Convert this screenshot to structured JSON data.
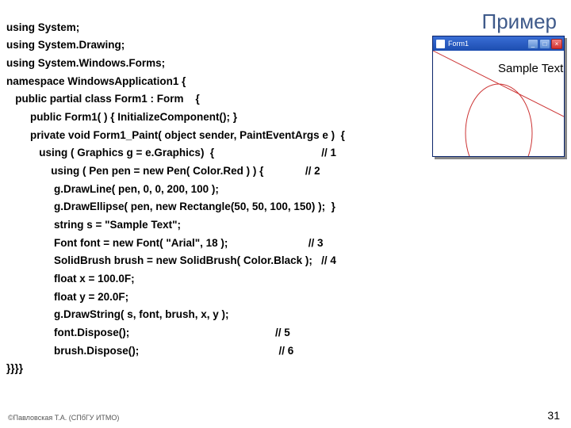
{
  "title": "Пример",
  "code_lines": [
    "using System;",
    "using System.Drawing;",
    "using System.Windows.Forms;",
    "namespace WindowsApplication1 {",
    "   public partial class Form1 : Form    {",
    "        public Form1( ) { InitializeComponent(); }",
    "        private void Form1_Paint( object sender, PaintEventArgs e )  {",
    "           using ( Graphics g = e.Graphics)  {                                    // 1",
    "               using ( Pen pen = new Pen( Color.Red ) ) {              // 2",
    "                g.DrawLine( pen, 0, 0, 200, 100 );",
    "                g.DrawEllipse( pen, new Rectangle(50, 50, 100, 150) );  }",
    "                string s = \"Sample Text\";",
    "                Font font = new Font( \"Arial\", 18 );                           // 3",
    "                SolidBrush brush = new SolidBrush( Color.Black );   // 4",
    "                float x = 100.0F;",
    "                float y = 20.0F;",
    "                g.DrawString( s, font, brush, x, y );",
    "                font.Dispose();                                                 // 5",
    "                brush.Dispose();                                               // 6",
    "}}}}"
  ],
  "footer": "©Павловская Т.А. (СПбГУ ИТМО)",
  "page_number": "31",
  "form": {
    "window_title": "Form1",
    "sample_text": "Sample Text",
    "btn_min": "_",
    "btn_max": "□",
    "btn_close": "×"
  }
}
